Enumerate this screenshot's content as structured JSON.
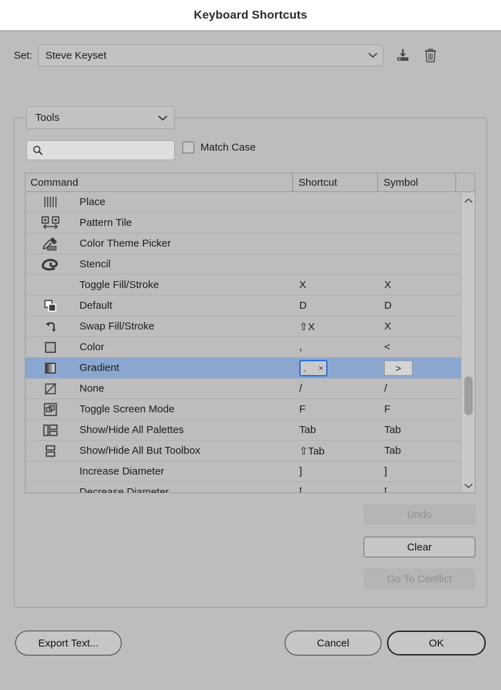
{
  "window": {
    "title": "Keyboard Shortcuts"
  },
  "set": {
    "label": "Set:",
    "value": "Steve Keyset",
    "save_icon": "save-icon",
    "delete_icon": "trash-icon",
    "chevron_icon": "chevron-down-icon"
  },
  "panel": {
    "category": {
      "value": "Tools"
    },
    "search": {
      "value": "",
      "placeholder": "",
      "icon": "search-icon"
    },
    "match_case": {
      "label": "Match Case",
      "checked": false
    }
  },
  "table": {
    "headers": {
      "command": "Command",
      "shortcut": "Shortcut",
      "symbol": "Symbol"
    },
    "rows": [
      {
        "icon": "place-icon",
        "command": "Place",
        "shortcut": "",
        "symbol": "",
        "selected": false
      },
      {
        "icon": "pattern-tile-icon",
        "command": "Pattern Tile",
        "shortcut": "",
        "symbol": "",
        "selected": false
      },
      {
        "icon": "color-theme-picker-icon",
        "command": "Color Theme Picker",
        "shortcut": "",
        "symbol": "",
        "selected": false
      },
      {
        "icon": "stencil-icon",
        "command": "Stencil",
        "shortcut": "",
        "symbol": "",
        "selected": false
      },
      {
        "icon": "",
        "command": "Toggle Fill/Stroke",
        "shortcut": "X",
        "symbol": "X",
        "selected": false
      },
      {
        "icon": "default-fill-stroke-icon",
        "command": "Default",
        "shortcut": "D",
        "symbol": "D",
        "selected": false
      },
      {
        "icon": "swap-fill-stroke-icon",
        "command": "Swap Fill/Stroke",
        "shortcut": "⇧X",
        "symbol": "X",
        "selected": false
      },
      {
        "icon": "color-icon",
        "command": "Color",
        "shortcut": ",",
        "symbol": "<",
        "selected": false
      },
      {
        "icon": "gradient-icon",
        "command": "Gradient",
        "shortcut": ".",
        "symbol": ">",
        "selected": true
      },
      {
        "icon": "none-icon",
        "command": "None",
        "shortcut": "/",
        "symbol": "/",
        "selected": false
      },
      {
        "icon": "toggle-screen-mode-icon",
        "command": "Toggle Screen Mode",
        "shortcut": "F",
        "symbol": "F",
        "selected": false
      },
      {
        "icon": "palettes-icon",
        "command": "Show/Hide All Palettes",
        "shortcut": "Tab",
        "symbol": "Tab",
        "selected": false
      },
      {
        "icon": "toolbox-icon",
        "command": "Show/Hide All But Toolbox",
        "shortcut": "⇧Tab",
        "symbol": "Tab",
        "selected": false
      },
      {
        "icon": "",
        "command": "Increase Diameter",
        "shortcut": "]",
        "symbol": "]",
        "selected": false
      },
      {
        "icon": "",
        "command": "Decrease Diameter",
        "shortcut": "[",
        "symbol": "[",
        "selected": false
      }
    ],
    "editing": {
      "shortcut_value": ".",
      "clear_glyph": "×",
      "symbol_value": ">"
    },
    "scrollbar": {
      "up_icon": "chevron-up-icon",
      "down_icon": "chevron-down-icon"
    }
  },
  "side_buttons": {
    "undo": {
      "label": "Undo",
      "enabled": false
    },
    "clear": {
      "label": "Clear",
      "enabled": true
    },
    "go_to_conflict": {
      "label": "Go To Conflict",
      "enabled": false
    }
  },
  "footer": {
    "export": "Export Text...",
    "cancel": "Cancel",
    "ok": "OK"
  },
  "colors": {
    "window_bg": "#bdbdbd",
    "titlebar_bg": "#ffffff",
    "selection": "#8ca7cf",
    "focus_border": "#2b6fd4"
  }
}
